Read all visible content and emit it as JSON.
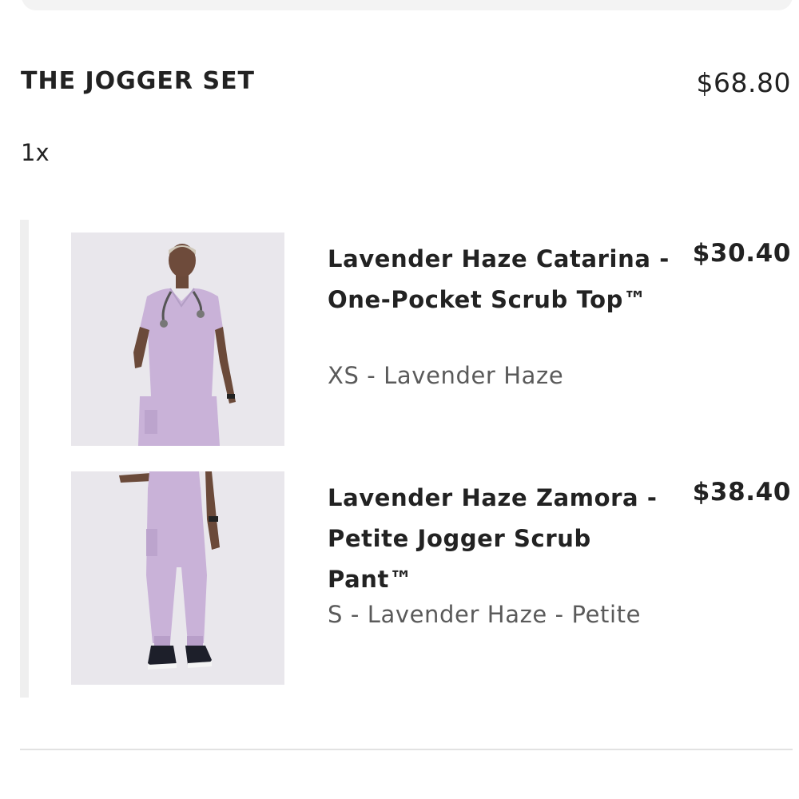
{
  "bundle": {
    "title": "THE JOGGER SET",
    "price": "$68.80",
    "quantity": "1x"
  },
  "items": [
    {
      "name": "Lavender Haze Catarina - One-Pocket Scrub Top™",
      "variant": "XS - Lavender Haze",
      "price": "$30.40",
      "image_icon": "scrub-top-photo"
    },
    {
      "name": "Lavender Haze Zamora - Petite Jogger Scrub Pant™",
      "variant": "S - Lavender Haze - Petite",
      "price": "$38.40",
      "image_icon": "jogger-pant-photo"
    }
  ],
  "colors": {
    "lavender": "#c9b2d8",
    "image_background": "#e9e7ec",
    "divider": "#e2e2e2"
  }
}
